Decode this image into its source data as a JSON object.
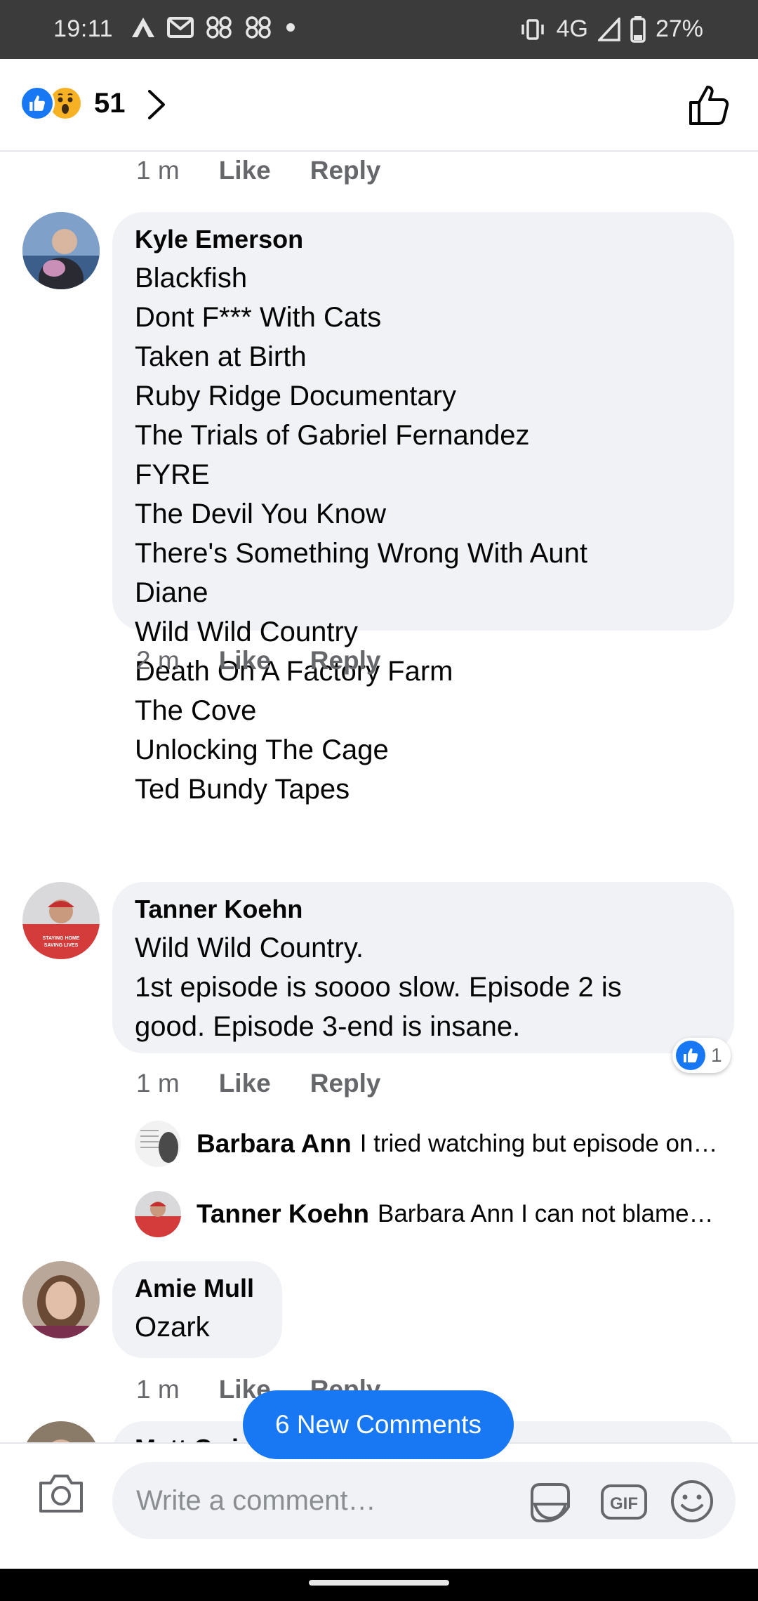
{
  "status_bar": {
    "time": "19:11",
    "network": "4G",
    "battery": "27%",
    "left_icons": [
      "a-icon",
      "mail-icon",
      "loop-icon",
      "loop-icon",
      "dot-icon"
    ],
    "right_icons": [
      "vibrate-icon",
      "signal-icon",
      "battery-icon"
    ]
  },
  "reactions_bar": {
    "count": "51",
    "reaction_icons": [
      "like-reaction-icon",
      "wow-reaction-icon"
    ]
  },
  "previous_meta": {
    "time": "1 m",
    "like": "Like",
    "reply": "Reply"
  },
  "comments": [
    {
      "author": "Kyle Emerson",
      "lines": [
        "Blackfish",
        "Dont F*** With Cats",
        "Taken at Birth",
        "Ruby Ridge Documentary",
        "The Trials of Gabriel Fernandez",
        "FYRE",
        "The Devil You Know",
        "There's Something Wrong With Aunt",
        "Diane",
        "Wild Wild Country",
        "Death On A Factory Farm",
        "The Cove",
        "Unlocking The Cage",
        "Ted Bundy Tapes"
      ],
      "time": "2 m",
      "like": "Like",
      "reply": "Reply"
    },
    {
      "author": "Tanner Koehn",
      "lines": [
        "Wild Wild Country.",
        "1st episode is soooo slow. Episode 2 is",
        "good. Episode 3-end is insane."
      ],
      "time": "1 m",
      "like": "Like",
      "reply": "Reply",
      "like_count": "1",
      "replies": [
        {
          "author": "Barbara Ann",
          "text": "I tried watching but episode on…"
        },
        {
          "author": "Tanner Koehn",
          "text": "Barbara Ann I can not blame…"
        }
      ]
    },
    {
      "author": "Amie Mull",
      "lines": [
        "Ozark"
      ],
      "time": "1 m",
      "like": "Like",
      "reply": "Reply"
    },
    {
      "author": "Matt Cwic"
    }
  ],
  "new_comments_button": "6 New Comments",
  "composer": {
    "placeholder": "Write a comment…",
    "gif_label": "GIF"
  },
  "colors": {
    "accent": "#1877f2",
    "bubble": "#f0f2f5",
    "meta_text": "#65676b",
    "status_bar": "#3b3b3c"
  }
}
